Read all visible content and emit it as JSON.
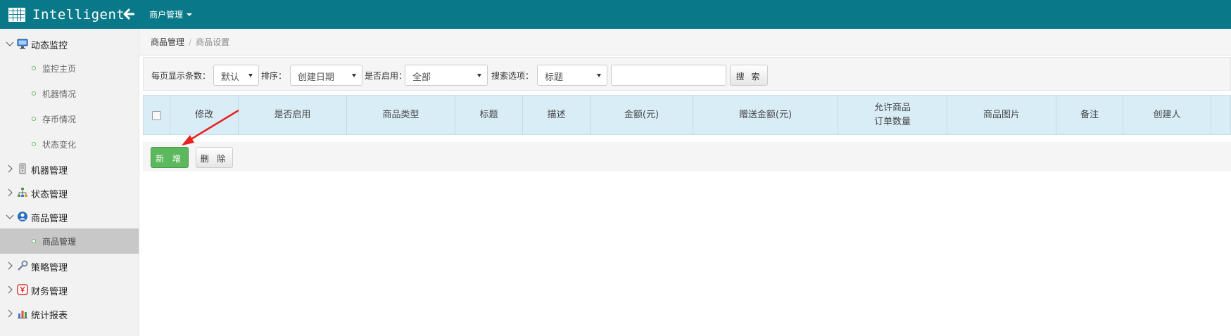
{
  "app": {
    "brand": "Intelligent",
    "top_menu": "商户管理"
  },
  "breadcrumb": [
    "商品管理",
    "商品设置"
  ],
  "sidebar": {
    "groups": [
      {
        "label": "动态监控",
        "expanded": true,
        "icon": "monitor-icon",
        "items": [
          "监控主页",
          "机器情况",
          "存币情况",
          "状态变化"
        ]
      },
      {
        "label": "机器管理",
        "expanded": false,
        "icon": "server-icon",
        "items": []
      },
      {
        "label": "状态管理",
        "expanded": false,
        "icon": "sitemap-icon",
        "items": []
      },
      {
        "label": "商品管理",
        "expanded": true,
        "icon": "user-circle-icon",
        "items": [
          "商品管理"
        ],
        "active_item": "商品管理"
      },
      {
        "label": "策略管理",
        "expanded": false,
        "icon": "wrench-icon",
        "items": []
      },
      {
        "label": "财务管理",
        "expanded": false,
        "icon": "yen-icon",
        "items": []
      },
      {
        "label": "统计报表",
        "expanded": false,
        "icon": "bar-chart-icon",
        "items": []
      }
    ]
  },
  "filters": {
    "page_size": {
      "label": "每页显示条数：",
      "value": "默认"
    },
    "sort": {
      "label": "排序：",
      "value": "创建日期"
    },
    "enabled": {
      "label": "是否启用：",
      "value": "全部"
    },
    "search_option": {
      "label": "搜索选项：",
      "value": "标题"
    },
    "search_input": {
      "value": "",
      "placeholder": ""
    },
    "search_button": "搜 索"
  },
  "table": {
    "columns": [
      "修改",
      "是否启用",
      "商品类型",
      "标题",
      "描述",
      "金额(元)",
      "赠送金额(元)",
      "允许商品订单数量",
      "商品图片",
      "备注",
      "创建人"
    ],
    "column_lines": {
      "允许商品订单数量": [
        "允许商品",
        "订单数量"
      ]
    },
    "rows": []
  },
  "actions": {
    "add": "新 增",
    "delete": "删 除"
  },
  "colors": {
    "topbar": "#09798a",
    "table_header": "#d9edf7",
    "add_button": "#5cb85c",
    "annotation_arrow": "#e8231f"
  }
}
